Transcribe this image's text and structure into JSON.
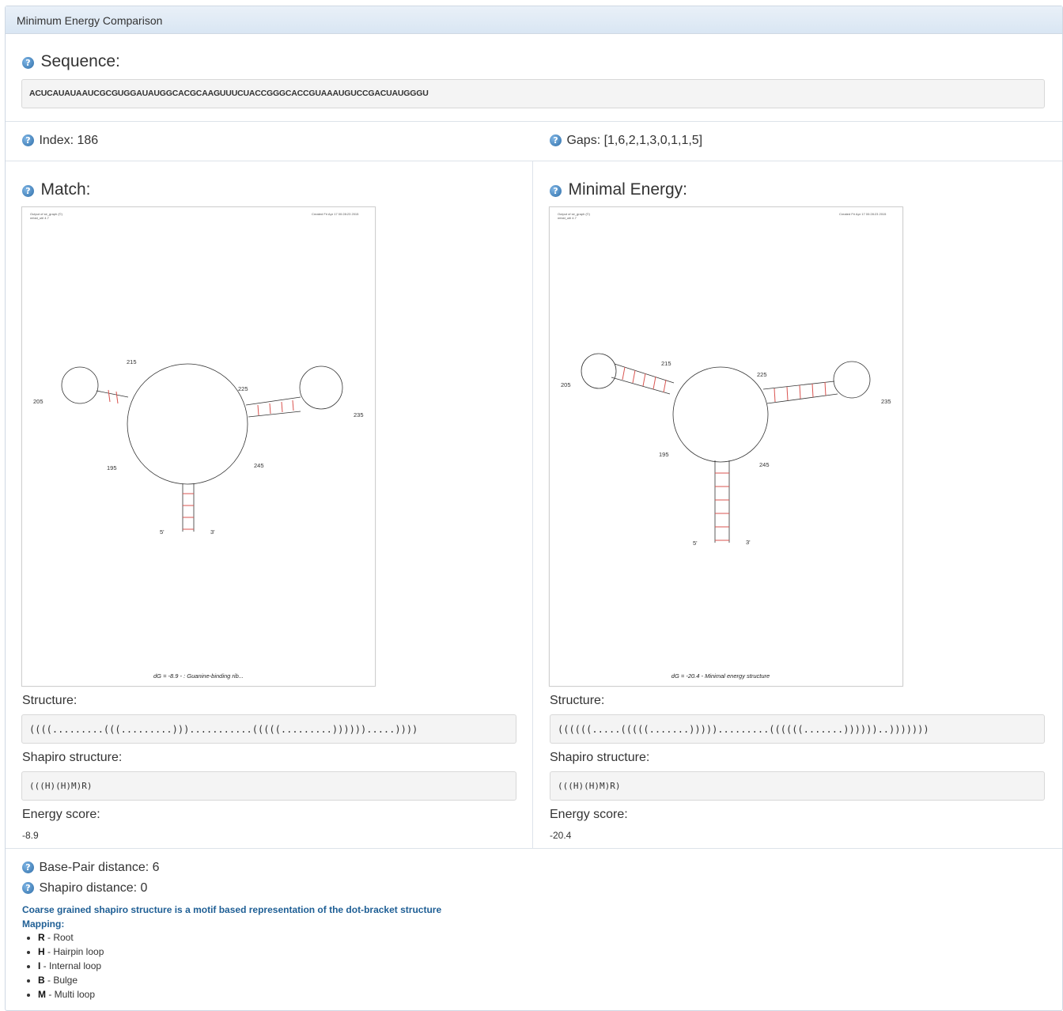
{
  "panel": {
    "title": "Minimum Energy Comparison"
  },
  "sequence": {
    "heading": "Sequence:",
    "value": "ACUCAUAUAAUCGCGUGGAUAUGGCACGCAAGUUUCUACCGGGCACCGUAAAUGUCCGACUAUGGGU"
  },
  "index": {
    "label": "Index: 186"
  },
  "gaps": {
    "label": "Gaps: [1,6,2,1,3,0,1,1,5]"
  },
  "match": {
    "heading": "Match:",
    "image": {
      "header_left_line1": "Output of sir_graph (©)",
      "header_left_line2": "mfold_util 4.7",
      "header_right": "Created Fri Apr 17 00:28:23 2015",
      "caption": "dG = -8.9 - : Guanine-binding rib...",
      "pos_215": "215",
      "pos_205": "205",
      "pos_195": "195",
      "pos_225": "225",
      "pos_235": "235",
      "pos_245": "245",
      "five_prime": "5'",
      "three_prime": "3'"
    },
    "structure_label": "Structure:",
    "structure": "((((.........(((.........)))...........(((((.........)))))).....))))",
    "shapiro_label": "Shapiro structure:",
    "shapiro": "(((H)(H)M)R)",
    "energy_label": "Energy score:",
    "energy": "-8.9"
  },
  "minimal": {
    "heading": "Minimal Energy:",
    "image": {
      "header_left_line1": "Output of sir_graph (©)",
      "header_left_line2": "mfold_util 4.7",
      "header_right": "Created Fri Apr 17 00:28:23 2015",
      "caption": "dG = -20.4 - Minimal energy structure",
      "pos_215": "215",
      "pos_205": "205",
      "pos_195": "195",
      "pos_225": "225",
      "pos_235": "235",
      "pos_245": "245",
      "five_prime": "5'",
      "three_prime": "3'"
    },
    "structure_label": "Structure:",
    "structure": "((((((.....(((((.......))))).........((((((.......))))))..)))))))",
    "shapiro_label": "Shapiro structure:",
    "shapiro": "(((H)(H)M)R)",
    "energy_label": "Energy score:",
    "energy": "-20.4"
  },
  "distances": {
    "base_pair": "Base-Pair distance: 6",
    "shapiro": "Shapiro distance: 0"
  },
  "notes": {
    "coarse": "Coarse grained shapiro structure is a motif based representation of the dot-bracket structure",
    "mapping": "Mapping:"
  },
  "mapping": [
    {
      "key": "R",
      "desc": " - Root"
    },
    {
      "key": "H",
      "desc": " - Hairpin loop"
    },
    {
      "key": "I",
      "desc": " - Internal loop"
    },
    {
      "key": "B",
      "desc": " - Bulge"
    },
    {
      "key": "M",
      "desc": " - Multi loop"
    }
  ],
  "colors": {
    "accent": "#1f5f95",
    "heading_bg": "#dbe7f4",
    "pair_line": "#d9534f",
    "help_icon": "#2f6ea8"
  },
  "icons": {
    "help": "question-circle-icon"
  }
}
